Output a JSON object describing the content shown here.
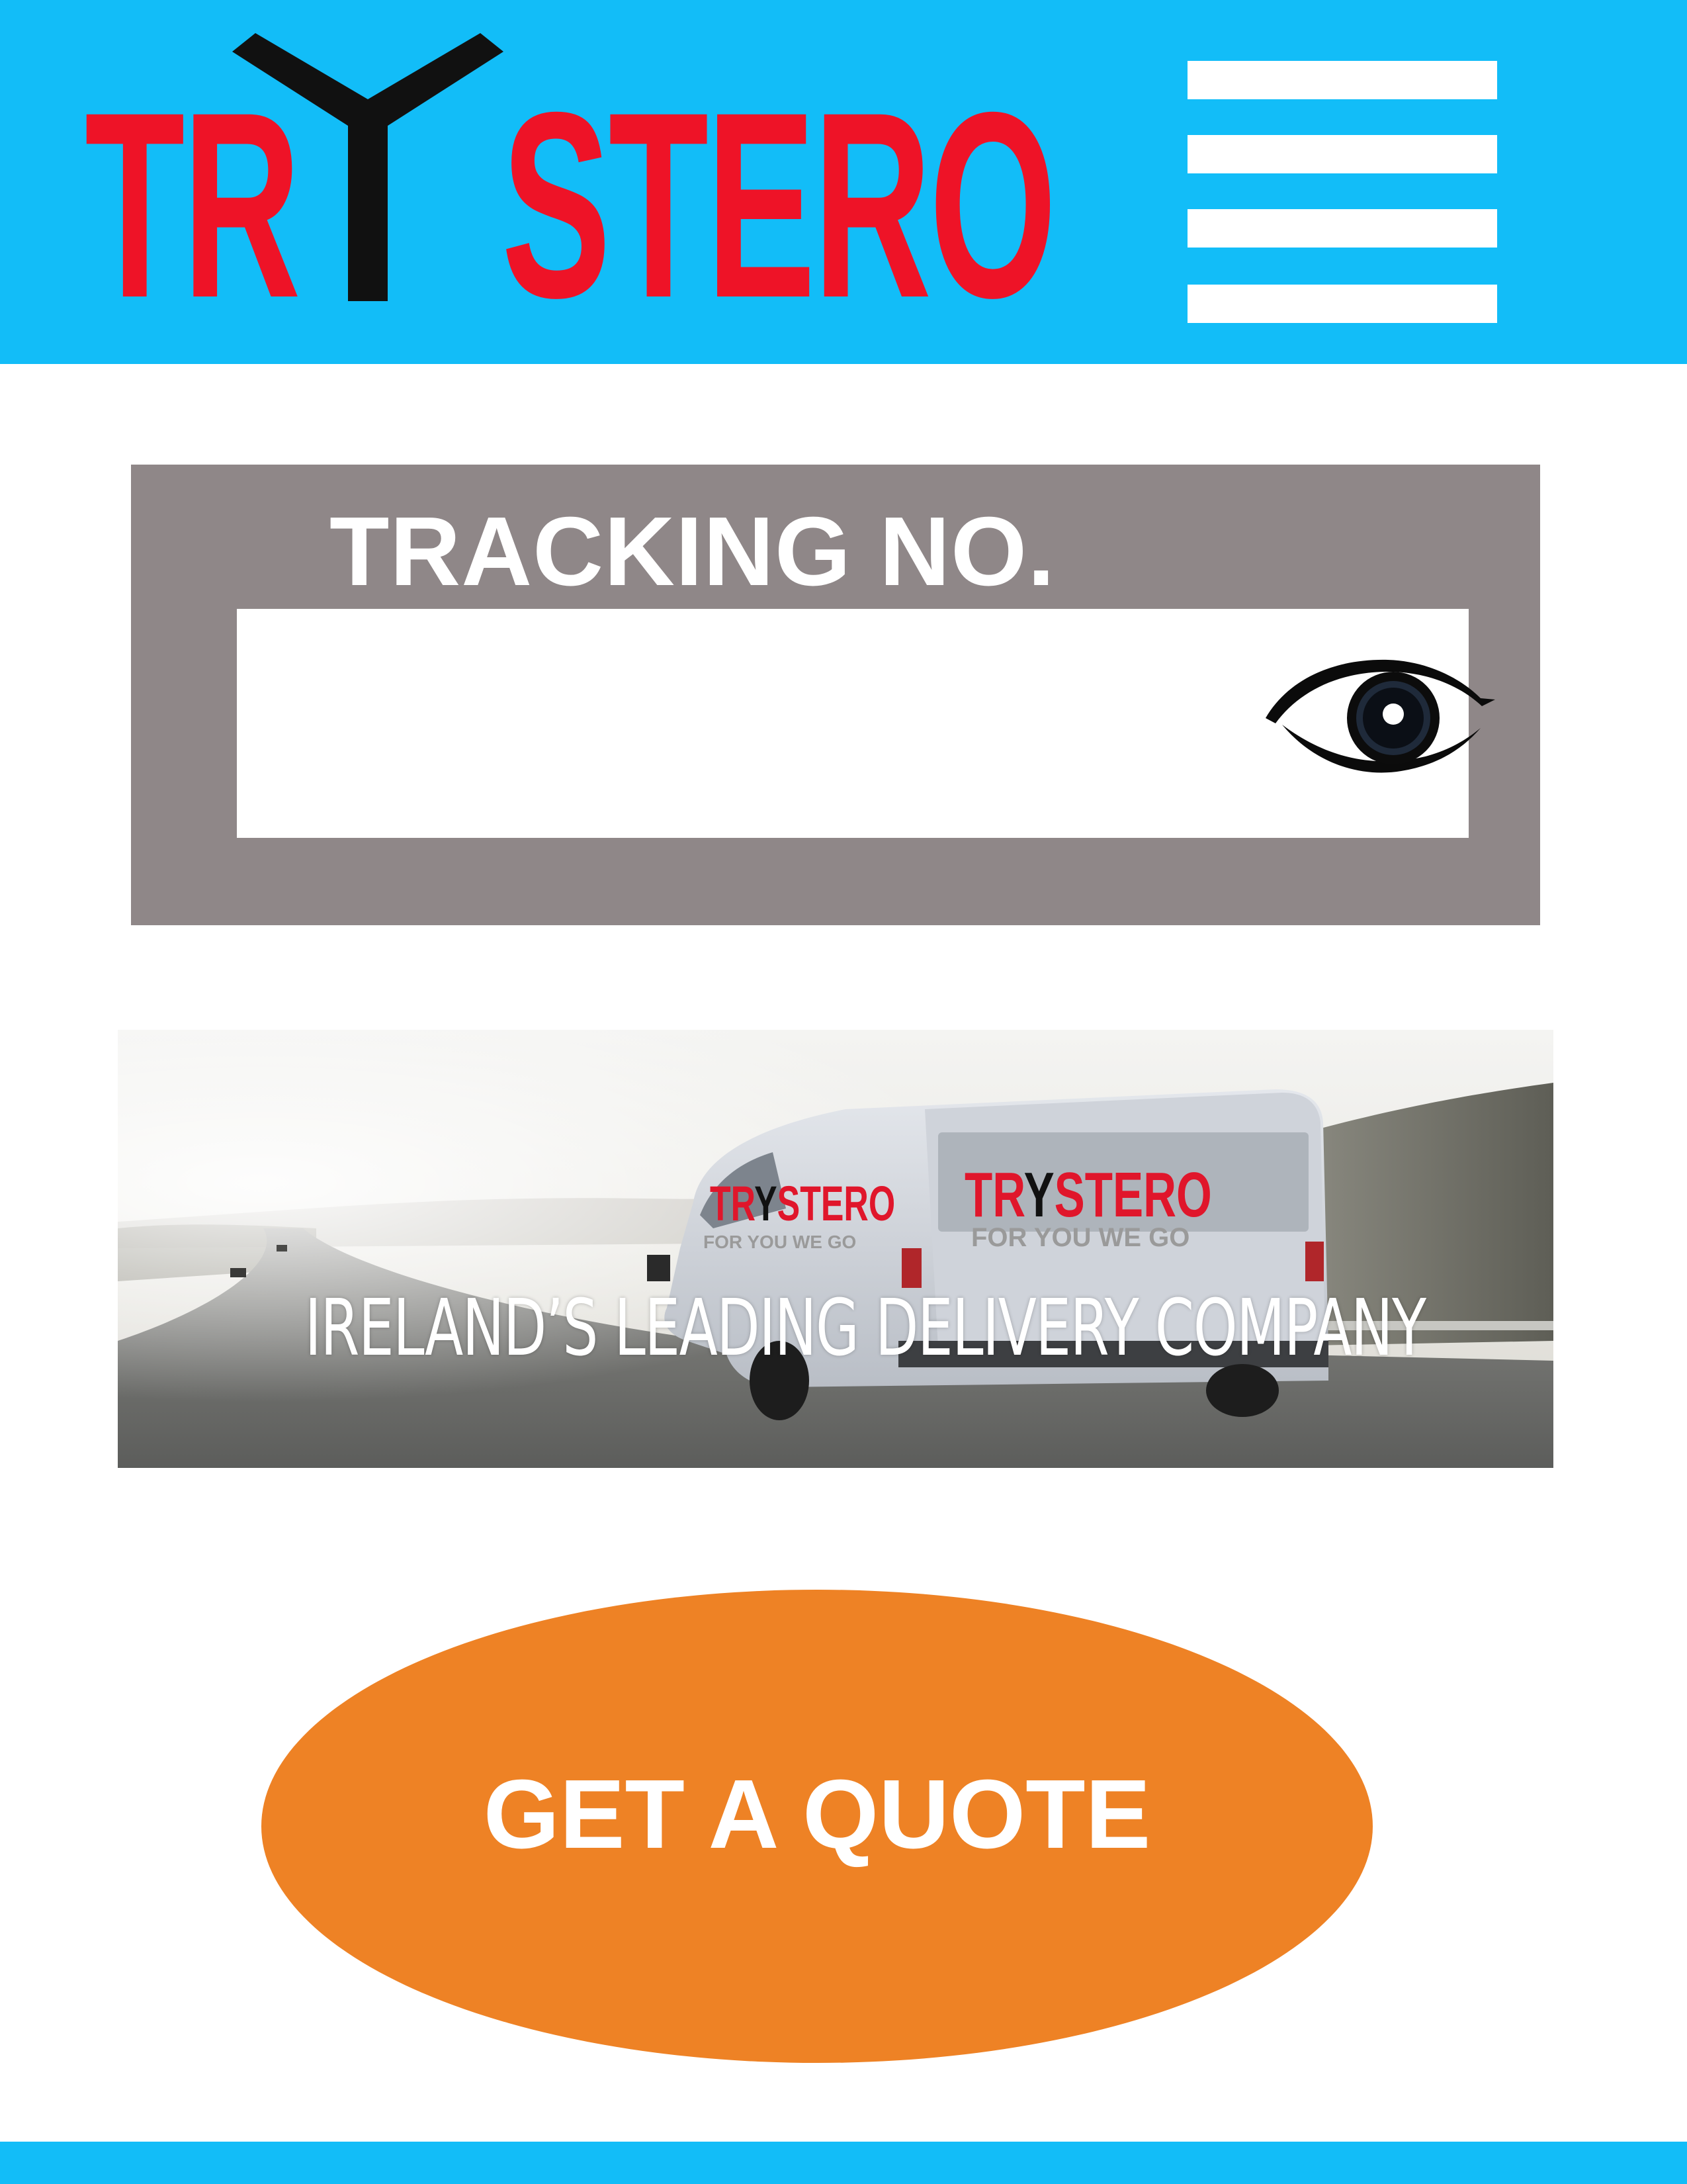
{
  "header": {
    "logo": {
      "text_left": "TR",
      "text_right": "STERO",
      "full_name": "TRYSTERO"
    },
    "menu": {
      "icon": "hamburger-menu-icon"
    }
  },
  "tracking": {
    "label": "TRACKING NO.",
    "input_value": "",
    "icon": "eye-icon"
  },
  "banner": {
    "caption": "IRELAND’S LEADING DELIVERY COMPANY",
    "van_logo_left": "TR",
    "van_logo_right": "STERO",
    "van_tagline": "FOR YOU WE GO"
  },
  "quote": {
    "label": "GET A QUOTE"
  },
  "colors": {
    "header_bg": "#12bdf8",
    "logo_red": "#ee1327",
    "panel_gray": "#8f8788",
    "quote_orange": "#ee8225",
    "white": "#ffffff",
    "black": "#111111"
  }
}
